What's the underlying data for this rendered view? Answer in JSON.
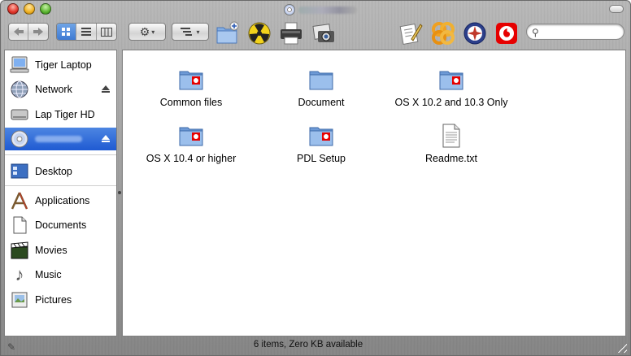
{
  "window": {
    "title_icon": "cd-disc-icon",
    "title_redacted": true
  },
  "toolbar": {
    "nav_back_icon": "back-arrow-icon",
    "nav_forward_icon": "forward-arrow-icon",
    "view_modes": [
      "icon-view",
      "list-view",
      "column-view"
    ],
    "active_view": "icon-view",
    "action_icon": "gear-icon",
    "arrange_icon": "arrange-icon",
    "search": {
      "value": "",
      "placeholder": ""
    }
  },
  "sidebar": {
    "devices": [
      {
        "label": "Tiger Laptop",
        "icon": "computer-icon",
        "eject": false
      },
      {
        "label": "Network",
        "icon": "network-globe-icon",
        "eject": true
      },
      {
        "label": "Lap Tiger HD",
        "icon": "hard-drive-icon",
        "eject": false
      },
      {
        "label": "",
        "icon": "cd-disc-icon",
        "eject": true,
        "selected": true,
        "redacted": true
      }
    ],
    "places": [
      {
        "label": "Desktop",
        "icon": "desktop-icon"
      },
      {
        "label": "Applications",
        "icon": "applications-icon"
      },
      {
        "label": "Documents",
        "icon": "documents-icon"
      },
      {
        "label": "Movies",
        "icon": "movies-icon"
      },
      {
        "label": "Music",
        "icon": "music-icon"
      },
      {
        "label": "Pictures",
        "icon": "pictures-icon"
      }
    ]
  },
  "files": [
    {
      "name": "Common files",
      "icon": "vodafone-folder-icon"
    },
    {
      "name": "Document",
      "icon": "folder-icon"
    },
    {
      "name": "OS X 10.2 and 10.3 Only",
      "icon": "vodafone-folder-icon"
    },
    {
      "name": "OS X 10.4 or higher",
      "icon": "vodafone-folder-icon"
    },
    {
      "name": "PDL Setup",
      "icon": "vodafone-folder-icon"
    },
    {
      "name": "Readme.txt",
      "icon": "text-document-icon"
    }
  ],
  "status": {
    "text": "6 items, Zero KB available"
  },
  "colors": {
    "selection": "#3a73d9",
    "folder_blue": "#7fa9e0",
    "vodafone_red": "#e60000"
  }
}
